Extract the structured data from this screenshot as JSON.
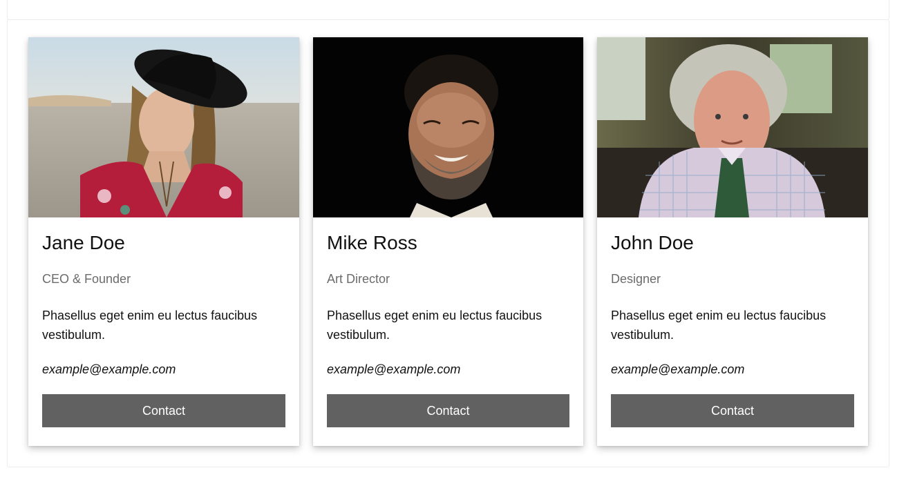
{
  "cards": [
    {
      "name": "Jane Doe",
      "role": "CEO & Founder",
      "description": "Phasellus eget enim eu lectus faucibus vestibulum.",
      "email": "example@example.com",
      "button_label": "Contact",
      "photo_icon": "portrait-woman-hat-photo"
    },
    {
      "name": "Mike Ross",
      "role": "Art Director",
      "description": "Phasellus eget enim eu lectus faucibus vestibulum.",
      "email": "example@example.com",
      "button_label": "Contact",
      "photo_icon": "portrait-bearded-man-photo"
    },
    {
      "name": "John Doe",
      "role": "Designer",
      "description": "Phasellus eget enim eu lectus faucibus vestibulum.",
      "email": "example@example.com",
      "button_label": "Contact",
      "photo_icon": "portrait-older-man-photo"
    }
  ],
  "colors": {
    "button_bg": "#616161",
    "button_text": "#ffffff",
    "role_text": "#6b6b6b",
    "card_bg": "#ffffff"
  }
}
